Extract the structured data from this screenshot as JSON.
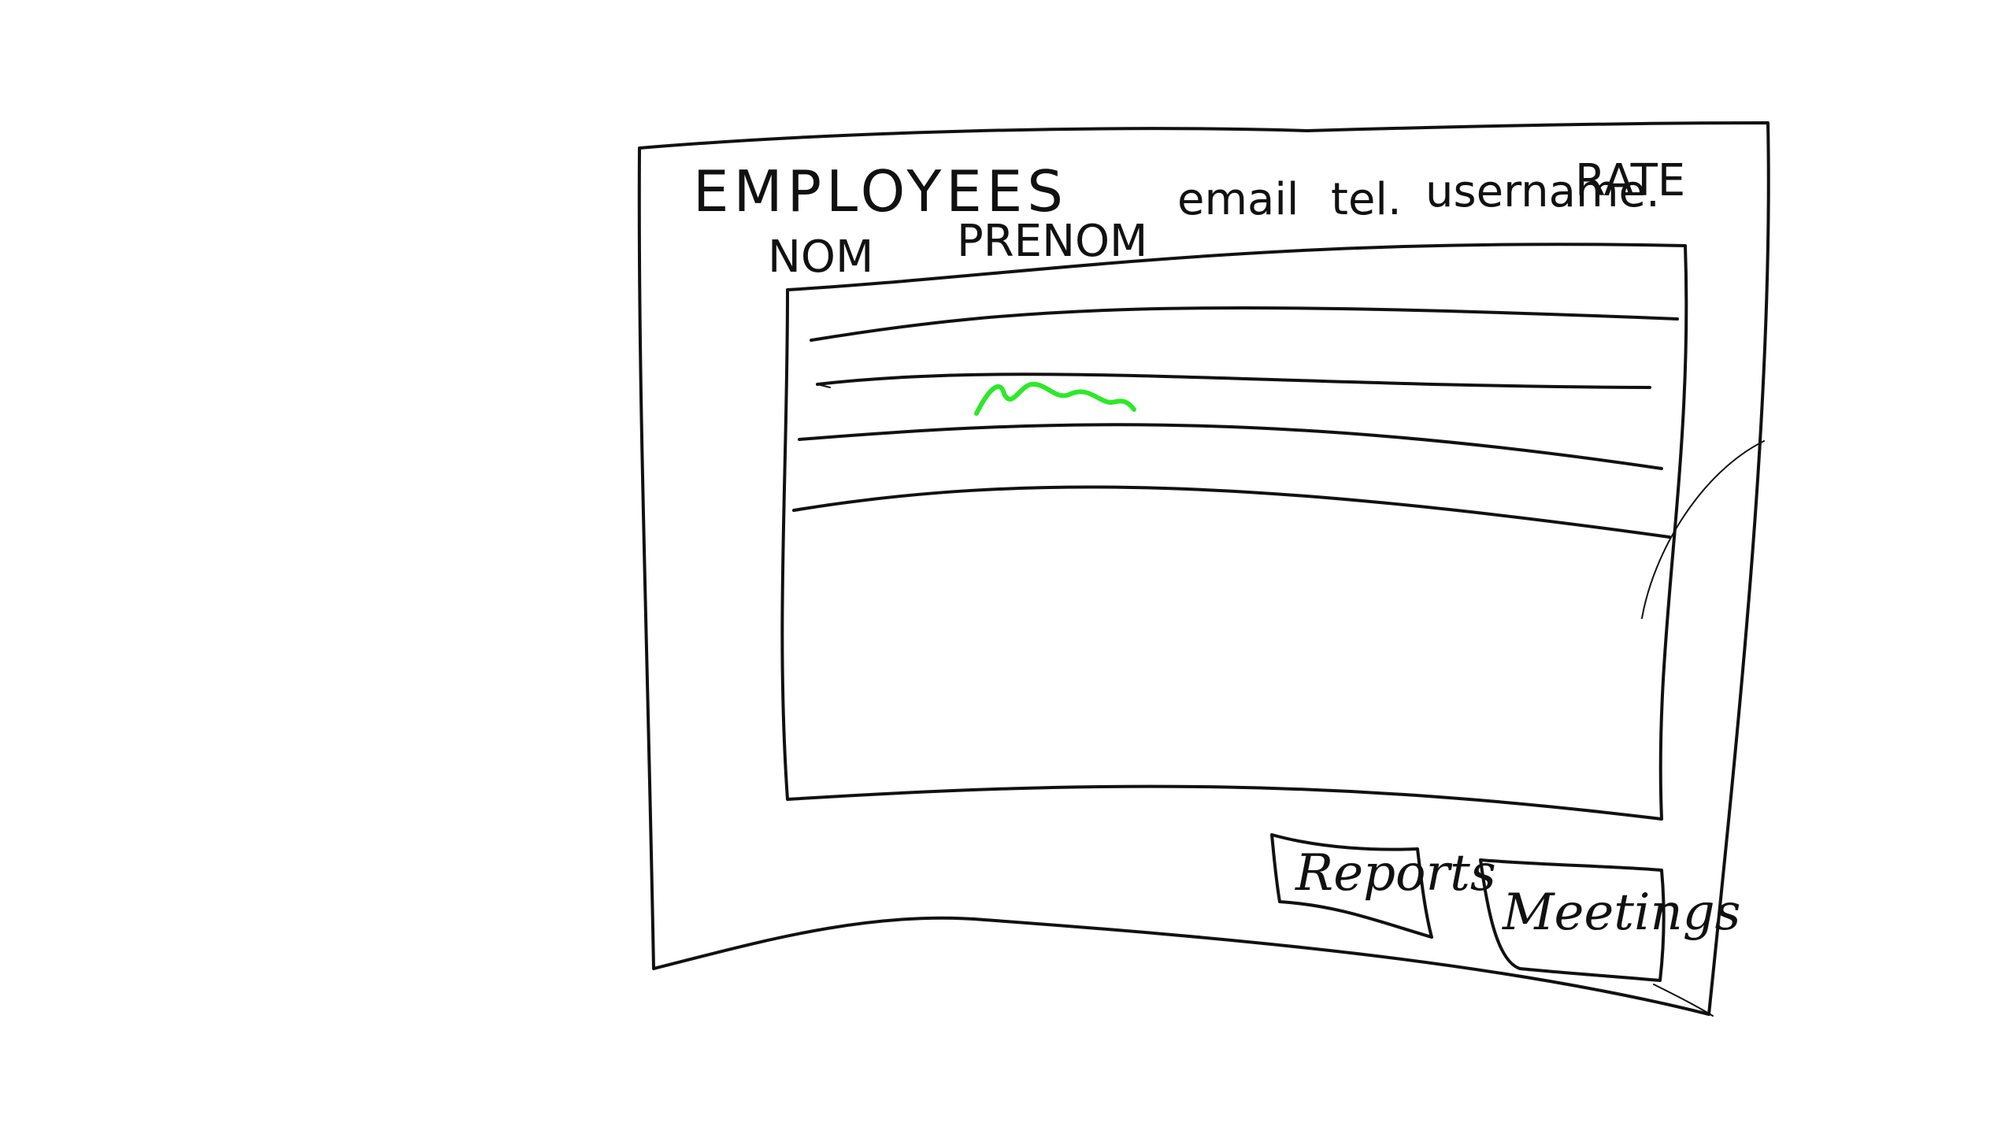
{
  "window": {
    "title": "EMPLOYEES"
  },
  "table": {
    "columns": [
      "NOM",
      "PRENOM",
      "email",
      "tel.",
      "username.",
      "RATE"
    ],
    "rows": 3,
    "selected_row": 1
  },
  "buttons": {
    "reports": "Reports",
    "meetings": "Meetings"
  },
  "colors": {
    "ink": "#111111",
    "highlight": "#2ee82a",
    "background": "#ffffff"
  }
}
